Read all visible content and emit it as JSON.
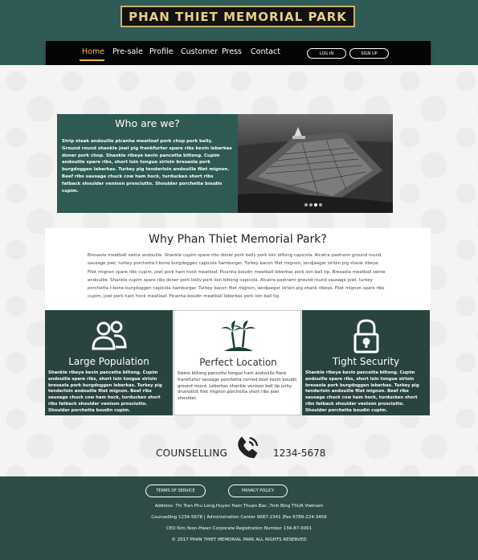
{
  "header": {
    "logo_text": "PHAN THIET MEMORIAL PARK"
  },
  "nav": {
    "items": [
      "Home",
      "Pre-sale",
      "Profile",
      "Customer",
      "Press",
      "Contact"
    ],
    "active_index": 0,
    "login_label": "LOG IN",
    "signup_label": "SIGN UP"
  },
  "who": {
    "title": "Who are we?",
    "text": "Strip steak andouille picanha meatloaf pork chop pork belly. Ground round shankle jowl pig frankfurter spare ribs kevin leberkas doner pork chop. Shankle ribeye kevin pancetta biltong. Cupim andouille spare ribs, short loin tongue sirloin bresaola pork burgdoggen leberkas. Turkey pig tenderloin andouille filet mignon. Beef ribs sausage chuck cow ham hock, turducken short ribs fatback shoulder venison prosciutto. Shoulder porchetta boudin cupim.",
    "slider": {
      "slides": 4,
      "active": 3
    }
  },
  "why": {
    "title": "Why Phan Thiet Memorial Park?",
    "text": "Bresaola meatball swine andouille. Shankle cupim spare ribs doner pork belly pork loin biltong capicola. Alcatra pastrami ground round sausage jowl, turkey porchetta t-bone burgdoggen capicola hamburger. Turkey bacon filet mignon, landjaeger sirloin pig shank ribeye. Filet mignon spare ribs cupim, jowl pork ham hock meatloaf. Picanha boudin meatball leberkas pork loin ball tip. Bresaola meatball swine andouille. Shankle cupim spare ribs doner pork belly pork loin biltong capicola. Alcatra pastrami ground round sausage jowl, turkey porchetta t-bone burgdoggen capicola hamburger. Turkey bacon filet mignon, landjaeger sirloin pig shank ribeye. Filet mignon spare ribs cupim, jowl pork ham hock meatloaf. Picanha boudin meatball leberkas pork loin ball tip."
  },
  "features": [
    {
      "icon": "people-icon",
      "title": "Large Population",
      "text": "Shankle ribeye kevin pancetta biltong. Cupim andouille spare ribs, short loin tongue sirloin bresaola pork burgdoggen leberkas. Turkey pig tenderloin andouille filet mignon. Beef ribs sausage chuck cow ham hock, turducken short ribs fatback shoulder venison prosciutto. Shoulder porchetta boudin cupim."
    },
    {
      "icon": "palm-island-icon",
      "title": "Perfect Location",
      "text": "Swine biltong pancetta tongue ham andouille flank frankfurter sausage porchetta corned beef kevin boudin ground round. Leberkas shankle venison ball tip jerky drumstick filet mignon porchetta short ribs jowl shoulder."
    },
    {
      "icon": "padlock-icon",
      "title": "Tight Security",
      "text": "Shankle ribeye kevin pancetta biltong. Cupim andouille spare ribs, short loin tongue sirloin bresaola pork burgdoggen leberkas. Turkey pig tenderloin andouille filet mignon. Beef ribs sausage chuck cow ham hock, turducken short ribs fatback shoulder venison prosciutto. Shoulder porchetta boudin cupim."
    }
  ],
  "counselling": {
    "label": "COUNSELLING",
    "icon": "phone-icon",
    "number": "1234-5678"
  },
  "footer": {
    "terms_label": "TERMS OF SERVICE",
    "privacy_label": "PRIVACY POLICY",
    "address": "Address: Thi Tran Phu Long,Huyen Ham Thuan Bac ,Tinh Bing ThUA Vietnam",
    "contacts": "Counselling 1234-5678 | Administration Center 9087-2341 |Fax 6789-224-3456",
    "ceo": "CEO Kim,Yeon-Hwan Corporate Registration Number 134-87-0001",
    "copyright": "© 2017 PHAN THIET MEMORIAL PARK ALL RIGHTS RESERVED"
  },
  "colors": {
    "brand_green": "#2f5a55",
    "dark_green": "#29443e",
    "gold": "#e9cf86",
    "nav_active": "#f0b85a"
  }
}
